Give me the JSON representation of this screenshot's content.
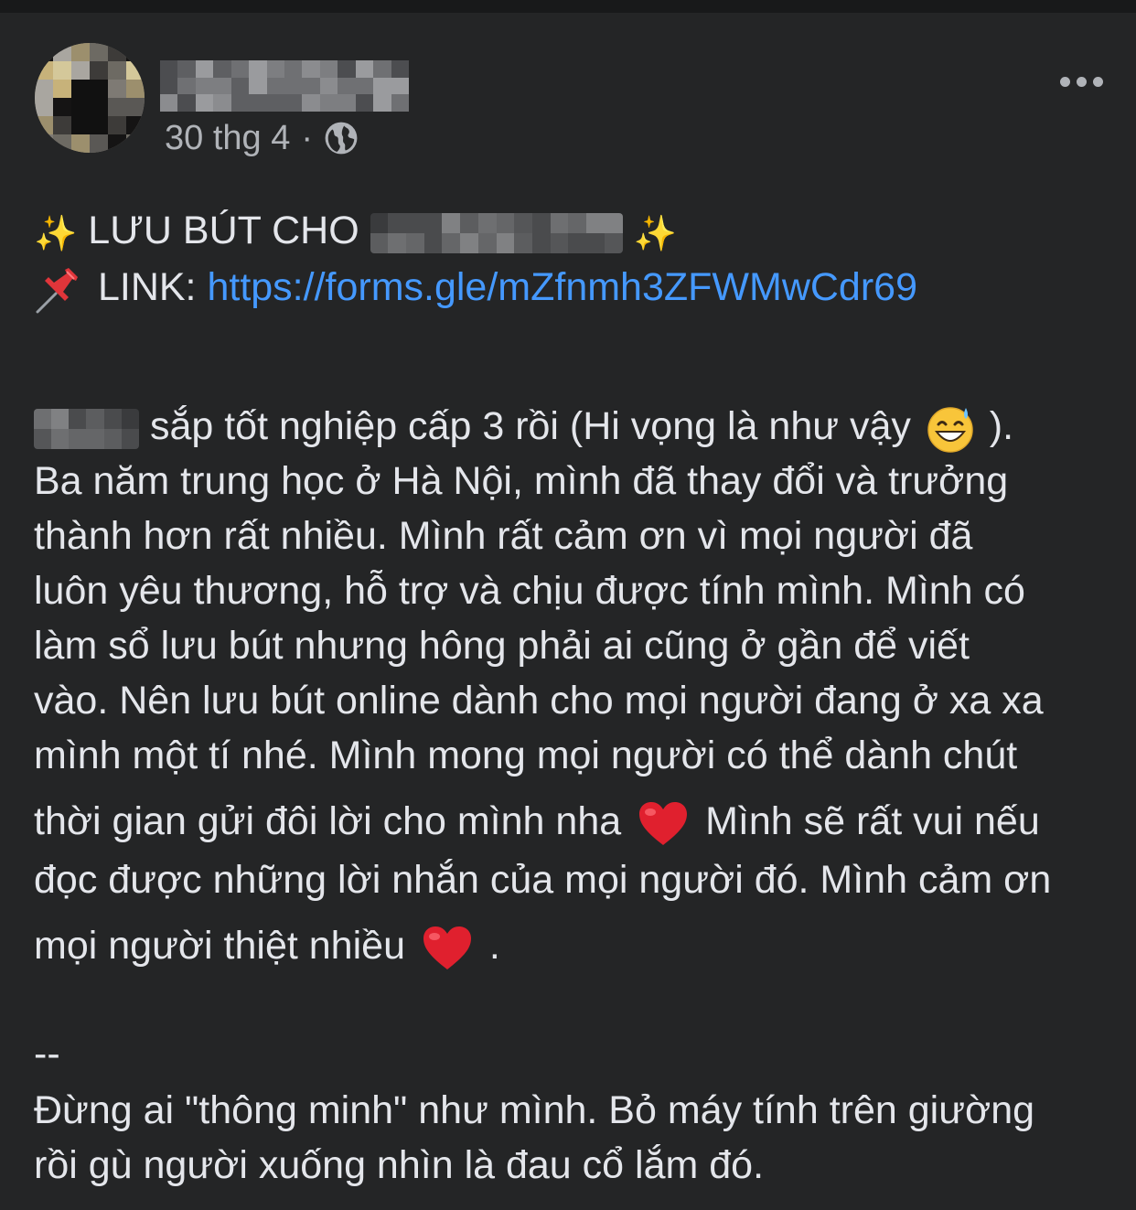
{
  "post": {
    "date": "30 thg 4",
    "separator": "·",
    "privacy_icon": "globe-icon",
    "more_icon": "more-options-icon"
  },
  "body": {
    "title_prefix": "LƯU BÚT CHO",
    "title_emoji": "sparkles-emoji",
    "link_label": "LINK:",
    "link_url": "https://forms.gle/mZfnmh3ZFWMwCdr69",
    "link_emoji": "pushpin-emoji",
    "p1_line1_after_name": "sắp tốt nghiệp cấp 3 rồi (Hi vọng là như vậy",
    "p1_line1_end": ").",
    "p1_line2": "Ba năm trung học ở Hà Nội, mình đã thay đổi và trưởng",
    "p1_line3": "thành hơn rất nhiều. Mình rất cảm ơn vì mọi người đã",
    "p1_line4": "luôn yêu thương, hỗ trợ và chịu được tính mình. Mình có",
    "p1_line5": "làm sổ lưu bút nhưng hông phải ai cũng ở gần để viết",
    "p1_line6": "vào. Nên lưu bút online dành cho mọi người đang ở xa xa",
    "p1_line7": "mình một tí nhé. Mình mong mọi người có thể dành chút",
    "p1_line8a": "thời gian gửi đôi lời cho mình nha",
    "p1_line8b": "Mình sẽ rất vui nếu",
    "p1_line9": "đọc được những lời nhắn của mọi người đó. Mình cảm ơn",
    "p1_line10": "mọi người thiệt nhiều",
    "p1_line10_end": ".",
    "divider": "--",
    "p2_line1": "Đừng ai \"thông minh\" như mình. Bỏ máy tính trên giường",
    "p2_line2": "rồi gù người xuống nhìn là đau cổ lắm đó."
  },
  "colors": {
    "background": "#242526",
    "text": "#e4e6eb",
    "secondary_text": "#b0b3b8",
    "link": "#4599ff",
    "heart": "#e0202e"
  }
}
